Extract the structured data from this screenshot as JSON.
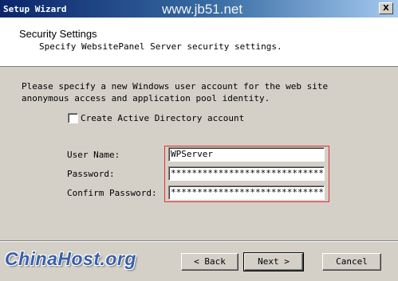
{
  "window": {
    "title": "Setup Wizard",
    "close_symbol": "X",
    "watermark": "www.jb51.net"
  },
  "header": {
    "title": "Security Settings",
    "subtitle": "Specify WebsitePanel Server security settings."
  },
  "body": {
    "description": "Please specify a new Windows user account for the web site anonymous access and application pool identity.",
    "create_ad_account": {
      "label": "Create Active Directory account",
      "checked": false
    },
    "fields": {
      "user_name_label": "User Name:",
      "user_name_value": "WPServer",
      "password_label": "Password:",
      "password_value": "********************************",
      "confirm_password_label": "Confirm Password:",
      "confirm_password_value": "********************************"
    }
  },
  "footer": {
    "back_label": "< Back",
    "next_label": "Next >",
    "cancel_label": "Cancel",
    "logo": "ChinaHost.org"
  },
  "colors": {
    "highlight_border": "#e03030",
    "title_bar_start": "#0a246a",
    "logo": "#3a5fa8"
  }
}
